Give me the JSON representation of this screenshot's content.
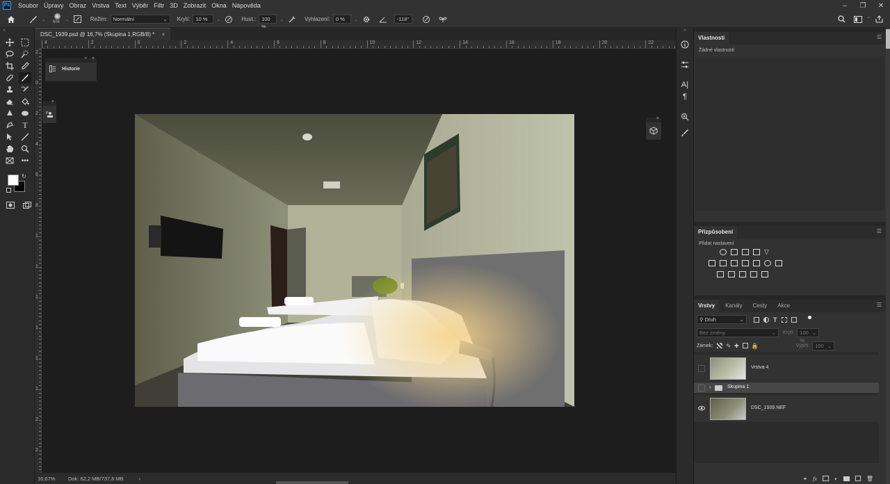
{
  "menu": {
    "items": [
      "Soubor",
      "Úpravy",
      "Obraz",
      "Vrstva",
      "Text",
      "Výběr",
      "Filtr",
      "3D",
      "Zobrazit",
      "Okna",
      "Nápověda"
    ],
    "logo": "Ps"
  },
  "options": {
    "brush_size": "606",
    "mode_label": "Režim:",
    "mode_value": "Normální",
    "opacity_label": "Krytí:",
    "opacity_value": "10 %",
    "flow_label": "Hust.:",
    "flow_value": "100 %",
    "smoothing_label": "Vyhlazení:",
    "smoothing_value": "0 %",
    "angle_value": "-118°"
  },
  "document": {
    "tab_title": "DSC_1939.psd @ 16,7% (Skupina 1,RGB/8) *",
    "close": "×"
  },
  "rulers": {
    "h_labels": [
      "4",
      "2",
      "0",
      "2",
      "4",
      "6",
      "8",
      "10",
      "12",
      "14",
      "16",
      "18",
      "20",
      "22"
    ],
    "v_labels": [
      "2",
      "0",
      "2",
      "4",
      "6",
      "8",
      "1",
      "1",
      "1",
      "1",
      "1",
      "1",
      "2",
      "2"
    ]
  },
  "history_panel": {
    "label": "Historie"
  },
  "properties": {
    "tab": "Vlastnosti",
    "empty": "Žádné vlastnosti"
  },
  "adjustments": {
    "tab": "Přizpůsobení",
    "add_label": "Přidat nastavení"
  },
  "layers": {
    "tabs": [
      "Vrstvy",
      "Kanály",
      "Cesty",
      "Akce"
    ],
    "filter_value": "Druh",
    "blend_value": "Bez změny",
    "opacity_label": "Krytí:",
    "opacity_value": "100 %",
    "lock_label": "Zámek:",
    "fill_label": "Výplň:",
    "fill_value": "100 %",
    "rows": [
      {
        "name": "Vrstva 4",
        "visible": false
      },
      {
        "name": "Skupina 1",
        "visible": false
      },
      {
        "name": "DSC_1939.NEF",
        "visible": true
      }
    ]
  },
  "status": {
    "zoom": "16,67%",
    "doc": "Dok: 62,2 MB/737,8 MB",
    "arrow": "›"
  },
  "colors": {
    "accent": "#31a8ff",
    "panel": "#323232",
    "canvas_bg": "#1d1d1d"
  }
}
